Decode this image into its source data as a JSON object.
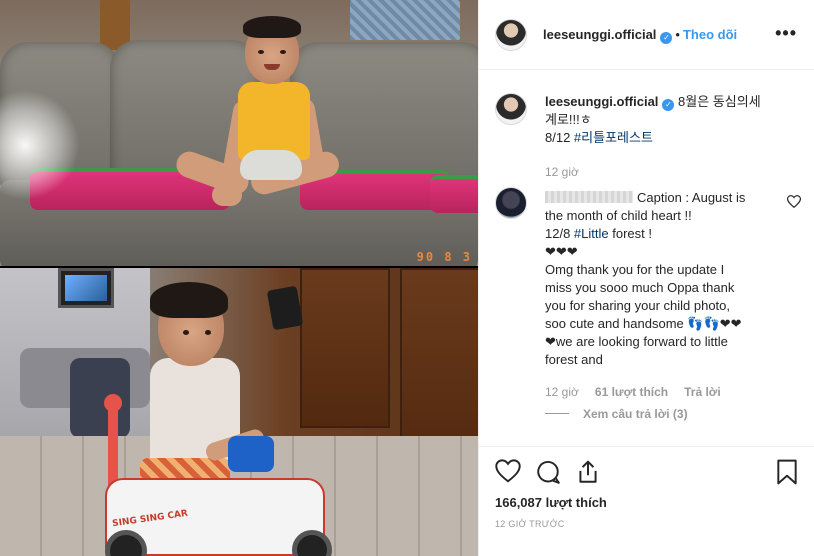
{
  "post": {
    "username": "leeseunggi.official",
    "verified_icon": "verified-badge-icon",
    "follow_label": "Theo dõi",
    "separator": "•",
    "more_label": "•••"
  },
  "photo": {
    "date_stamp": "90 8 3"
  },
  "caption": {
    "username": "leeseunggi.official",
    "text_line1": "8월은 동심의세",
    "text_line2": "계로!!!ㅎ",
    "text_line3_prefix": "8/12 ",
    "hashtag": "#리틀포레스트",
    "time": "12 giờ"
  },
  "comment": {
    "caption_line1": "Caption : August is",
    "caption_line2": "the month of child heart !!",
    "line3_prefix": "12/8 ",
    "hashtag": "#Little",
    "line3_suffix": " forest !",
    "hearts": "❤❤❤",
    "body_line1": "Omg thank you for the update I",
    "body_line2": "miss you sooo much Oppa thank",
    "body_line3": "you for sharing your child photo,",
    "body_line4": "soo cute and handsome 👣👣❤❤",
    "body_line5": "❤we are looking forward to little",
    "body_line6": "forest and",
    "time": "12 giờ",
    "likes": "61 lượt thích",
    "reply": "Trả lời",
    "view_replies": "Xem câu trả lời (3)"
  },
  "footer": {
    "likes": "166,087 lượt thích",
    "time_ago": "12 GIỜ TRƯỚC"
  },
  "toy_label": "SING SING CAR"
}
